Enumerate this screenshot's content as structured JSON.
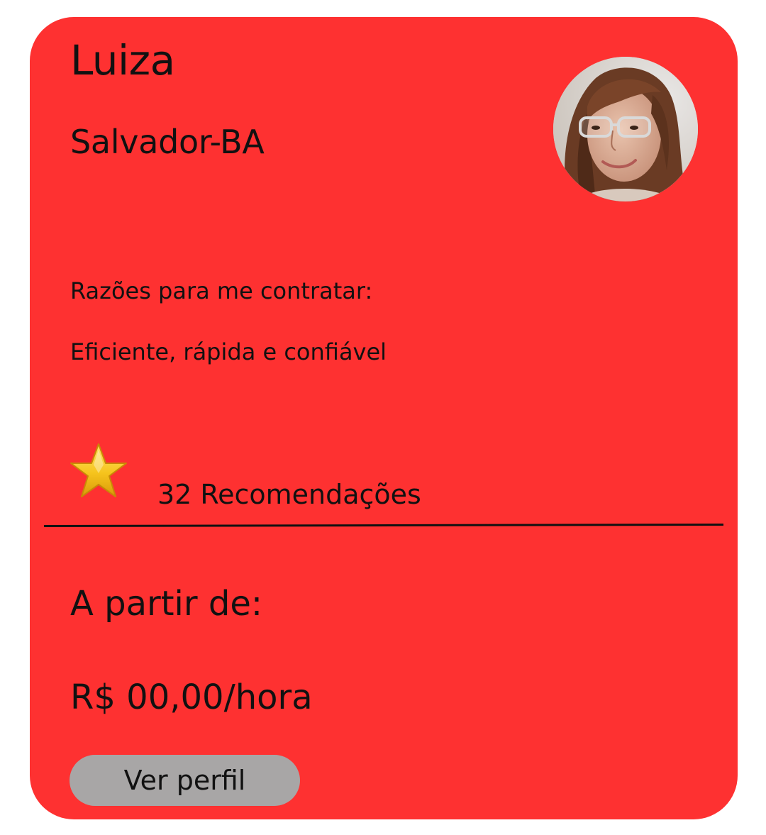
{
  "card": {
    "background_color": "#fe3131",
    "name": "Luiza",
    "location": "Salvador-BA",
    "avatar_icon": "profile-photo",
    "reasons": {
      "label": "Razões para me contratar:",
      "text": "Eficiente, rápida e confiável"
    },
    "recommendations": {
      "icon": "star-icon",
      "text": "32 Recomendações"
    },
    "pricing": {
      "label": "A partir de:",
      "price": "R$ 00,00/hora"
    },
    "button": {
      "label": "Ver perfil",
      "color": "#a8a6a6"
    }
  }
}
